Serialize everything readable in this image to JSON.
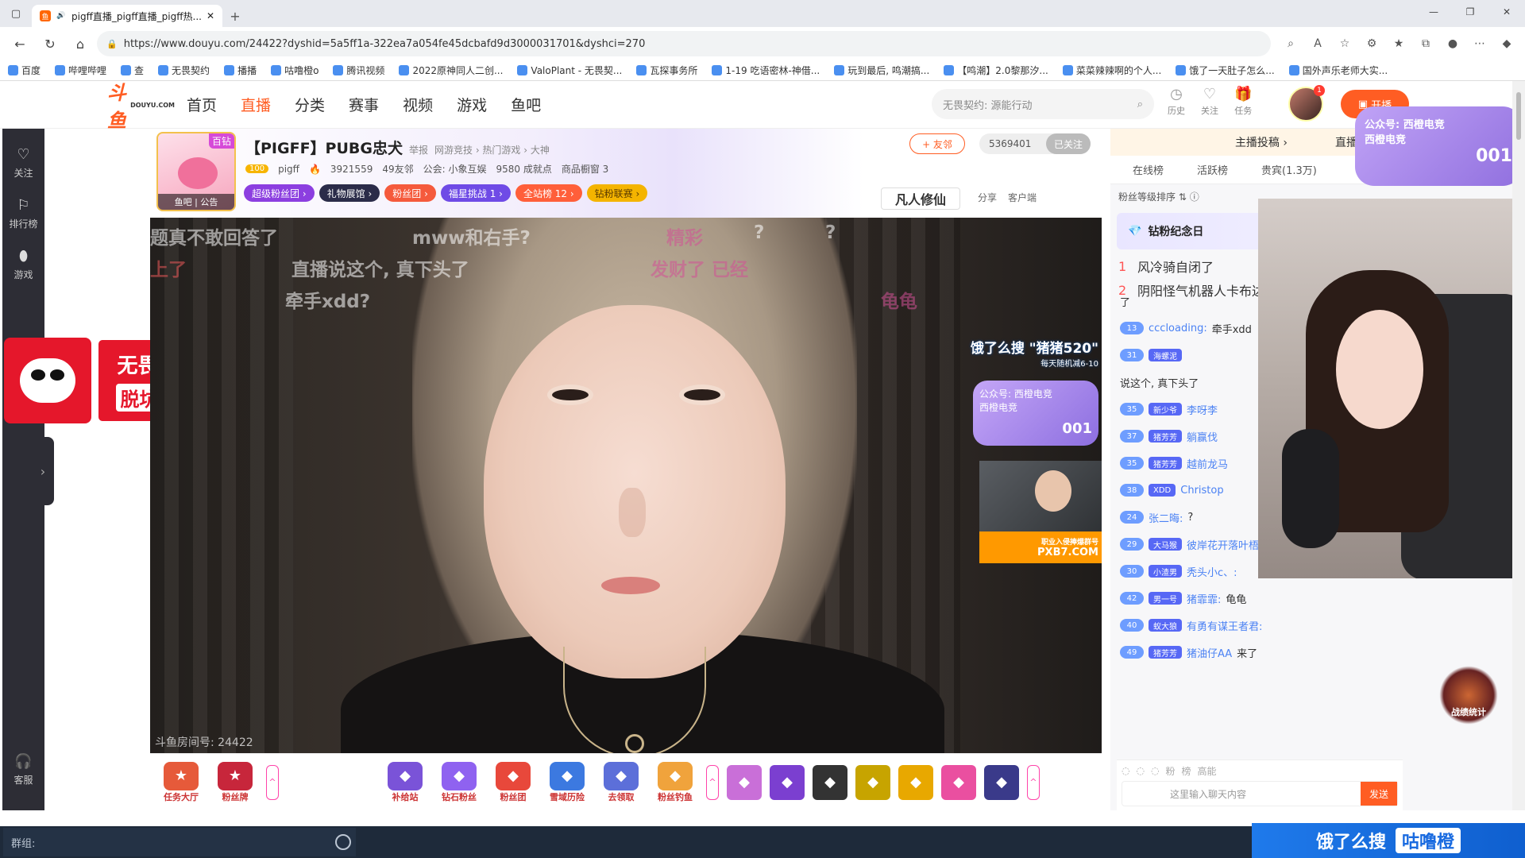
{
  "browser": {
    "tab_title": "pigff直播_pigff直播_pigff热...",
    "url": "https://www.douyu.com/24422?dyshid=5a5ff1a-322ea7a054fe45dcbafd9d3000031701&dyshci=270",
    "bookmarks": [
      "百度",
      "哔哩哔哩",
      "查",
      "无畏契约",
      "播播",
      "咕噜橙o",
      "腾讯视频",
      "2022原神同人二创...",
      "ValoPlant - 无畏契...",
      "瓦探事务所",
      "1-19 吃语密林-神借...",
      "玩到最后, 鸣潮搞...",
      "【鸣潮】2.0黎那汐...",
      "菜菜辣辣啊的个人...",
      "饿了一天肚子怎么...",
      "国外声乐老师大实..."
    ]
  },
  "header": {
    "logo": "斗鱼",
    "logo_sub": "DOUYU.COM",
    "nav": [
      "首页",
      "直播",
      "分类",
      "赛事",
      "视频",
      "游戏",
      "鱼吧"
    ],
    "search_placeholder": "无畏契约: 源能行动",
    "icons": [
      {
        "icon": "history-icon",
        "label": "历史"
      },
      {
        "icon": "heart-icon",
        "label": "关注"
      },
      {
        "icon": "gift-icon",
        "label": "任务"
      }
    ],
    "avatar_badge": "1",
    "start_label": "开播"
  },
  "left_sidebar": {
    "items": [
      {
        "icon": "heart-icon",
        "label": "关注"
      },
      {
        "icon": "rank-icon",
        "label": "排行榜"
      },
      {
        "icon": "game-icon",
        "label": "游戏"
      }
    ],
    "service": "客服"
  },
  "promo": {
    "line1": "无畏契约",
    "line2": "脱坑好价"
  },
  "room": {
    "title": "【PIGFF】PUBG忠犬",
    "report": "举报",
    "category": "网游竞技 › 热门游戏 › 大神",
    "avatar_level": "百钻",
    "avatar_footer": "鱼吧 | 公告",
    "streamer": "pigff",
    "level": "100",
    "heat": "3921559",
    "friends": "49友邻",
    "guild": "公会: 小象互娱",
    "points": "9580 成就点",
    "shop": "商品橱窗 3",
    "follow_label": "+ 友邻",
    "follow_count": "5369401",
    "followed": "已关注",
    "chips": [
      "超级粉丝团",
      "礼物展馆",
      "粉丝团",
      "福星挑战 1",
      "全站榜 12",
      "钻粉联赛"
    ],
    "game": "凡人修仙",
    "share": "分享",
    "client": "客户端",
    "room_number": "斗鱼房间号: 24422"
  },
  "video": {
    "danmaku": [
      "题真不敢回答了",
      "mww和右手?",
      "精彩",
      "?",
      "?",
      "上了",
      "直播说这个, 真下头了",
      "发财了 已经",
      "牵手xdd?",
      "龟龟"
    ],
    "ad_search": "饿了么搜 \"猪猪520\"",
    "ad_search_sub": "每天随机减6-10",
    "sticker_line1": "公众号: 西橙电竞",
    "sticker_line2": "西橙电竞",
    "sticker_num": "001",
    "pip_ad1": "职业入侵捧爆群号",
    "pip_ad2": "PXB7.COM"
  },
  "gift_bar": {
    "left": [
      {
        "label": "任务大厅",
        "color": "#e65a3a"
      },
      {
        "label": "粉丝牌",
        "color": "#c7263b"
      }
    ],
    "mid": [
      {
        "label": "补给站",
        "color": "#7a53d8"
      },
      {
        "label": "钻石粉丝",
        "color": "#8f62f0"
      },
      {
        "label": "粉丝团",
        "color": "#e8483b"
      },
      {
        "label": "雪域历险",
        "color": "#3c79e0"
      },
      {
        "label": "去领取",
        "color": "#5c6fd9"
      },
      {
        "label": "粉丝钓鱼",
        "color": "#f0a33c"
      }
    ]
  },
  "right_panel": {
    "top": [
      "主播投稿",
      "直播回看"
    ],
    "tabs": [
      "在线榜",
      "活跃榜",
      "贵宾(1.3万)"
    ],
    "rank_sort": "粉丝等级排序",
    "anniversary": "钻粉纪念日",
    "rank_list": [
      {
        "rank": "1",
        "name": "风冷骑自闭了"
      },
      {
        "rank": "2",
        "name": "阴阳怪气机器人卡布达"
      }
    ],
    "messages": [
      {
        "lv": "",
        "badge": "",
        "user": "",
        "text": "了"
      },
      {
        "lv": "13",
        "badge": "",
        "user": "cccloading:",
        "text": "牵手xdd"
      },
      {
        "lv": "31",
        "badge": "海螺泥",
        "user": "",
        "text": ""
      },
      {
        "lv": "",
        "badge": "",
        "user": "",
        "text": "说这个, 真下头了"
      },
      {
        "lv": "35",
        "badge": "新少爷",
        "user": "李呀李",
        "text": ""
      },
      {
        "lv": "37",
        "badge": "猪芳芳",
        "user": "躺赢伐",
        "text": ""
      },
      {
        "lv": "35",
        "badge": "猪芳芳",
        "user": "越前龙马",
        "text": ""
      },
      {
        "lv": "38",
        "badge": "XDD",
        "user": "Christop",
        "text": ""
      },
      {
        "lv": "24",
        "badge": "",
        "user": "张二晦:",
        "text": "?"
      },
      {
        "lv": "29",
        "badge": "大马猴",
        "user": "彼岸花开落叶梧桐:",
        "text": "?"
      },
      {
        "lv": "30",
        "badge": "小渣男",
        "user": "秃头小c、:",
        "text": ""
      },
      {
        "lv": "42",
        "badge": "男一号",
        "user": "猪霏霏:",
        "text": "龟龟"
      },
      {
        "lv": "40",
        "badge": "蚁大狼",
        "user": "有勇有谋王者君:",
        "text": ""
      },
      {
        "lv": "49",
        "badge": "猪芳芳",
        "user": "猪油仔AA",
        "text": "来了"
      }
    ],
    "chat_tools": [
      "粉",
      "榜",
      "高能"
    ],
    "input_placeholder": "这里输入聊天内容",
    "send": "发送"
  },
  "cam": {
    "line1": "公众号: 西橙电竞",
    "line2": "西橙电竞",
    "num": "001"
  },
  "game_stat": "战绩统计",
  "taskbar": {
    "group": "群组:"
  },
  "bottom_ad": {
    "left": "饿了么搜",
    "right": "咕噜橙"
  }
}
